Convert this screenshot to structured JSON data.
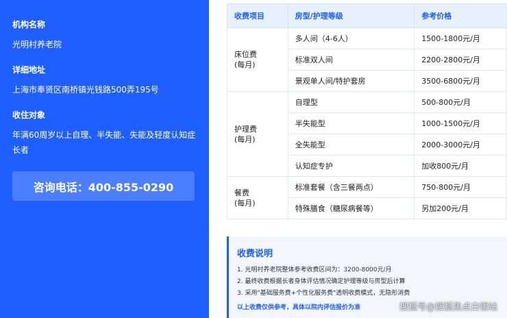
{
  "left": {
    "org_label": "机构名称",
    "org_value": "光明村养老院",
    "addr_label": "详细地址",
    "addr_value": "上海市奉贤区南桥镇光钱路500弄195号",
    "target_label": "收住对象",
    "target_value": "年满60周岁以上自理、半失能、失能及轻度认知症长者",
    "phone": "咨询电话：400-855-0290"
  },
  "table": {
    "headers": [
      "收费项目",
      "房型/护理等级",
      "参考价格"
    ],
    "cat_bed_1": "床位费",
    "cat_bed_2": "(每月)",
    "cat_care_1": "护理费",
    "cat_care_2": "(每月)",
    "cat_meal_1": "餐费",
    "cat_meal_2": "(每月)",
    "rows": [
      {
        "type": "多人间（4-6人）",
        "price": "1500-1800元/月"
      },
      {
        "type": "标准双人间",
        "price": "2200-2800元/月"
      },
      {
        "type": "景观单人间/特护套房",
        "price": "3500-6800元/月"
      },
      {
        "type": "自理型",
        "price": "500-800元/月"
      },
      {
        "type": "半失能型",
        "price": "1000-1500元/月"
      },
      {
        "type": "全失能型",
        "price": "2000-3000元/月"
      },
      {
        "type": "认知症专护",
        "price": "加收800元/月"
      },
      {
        "type": "标准套餐（含三餐两点）",
        "price": "750-800元/月"
      },
      {
        "type": "特殊膳食（糖尿病餐等）",
        "price": "另加200元/月"
      }
    ]
  },
  "notes": {
    "title": "收费说明",
    "items": [
      "1. 光明村养老院整体参考收费区间为：3200-8000元/月",
      "2. 最终收费根据长者身体评估情况确定护理等级与房型后计算",
      "3. 采用\"基础服务费+个性化服务费\"透明收费模式，无隐形消费"
    ],
    "footer": "以上收费仅供参考，具体以院内评估报价为准"
  },
  "watermark": "搜狐号@搜狐焦点白银站"
}
